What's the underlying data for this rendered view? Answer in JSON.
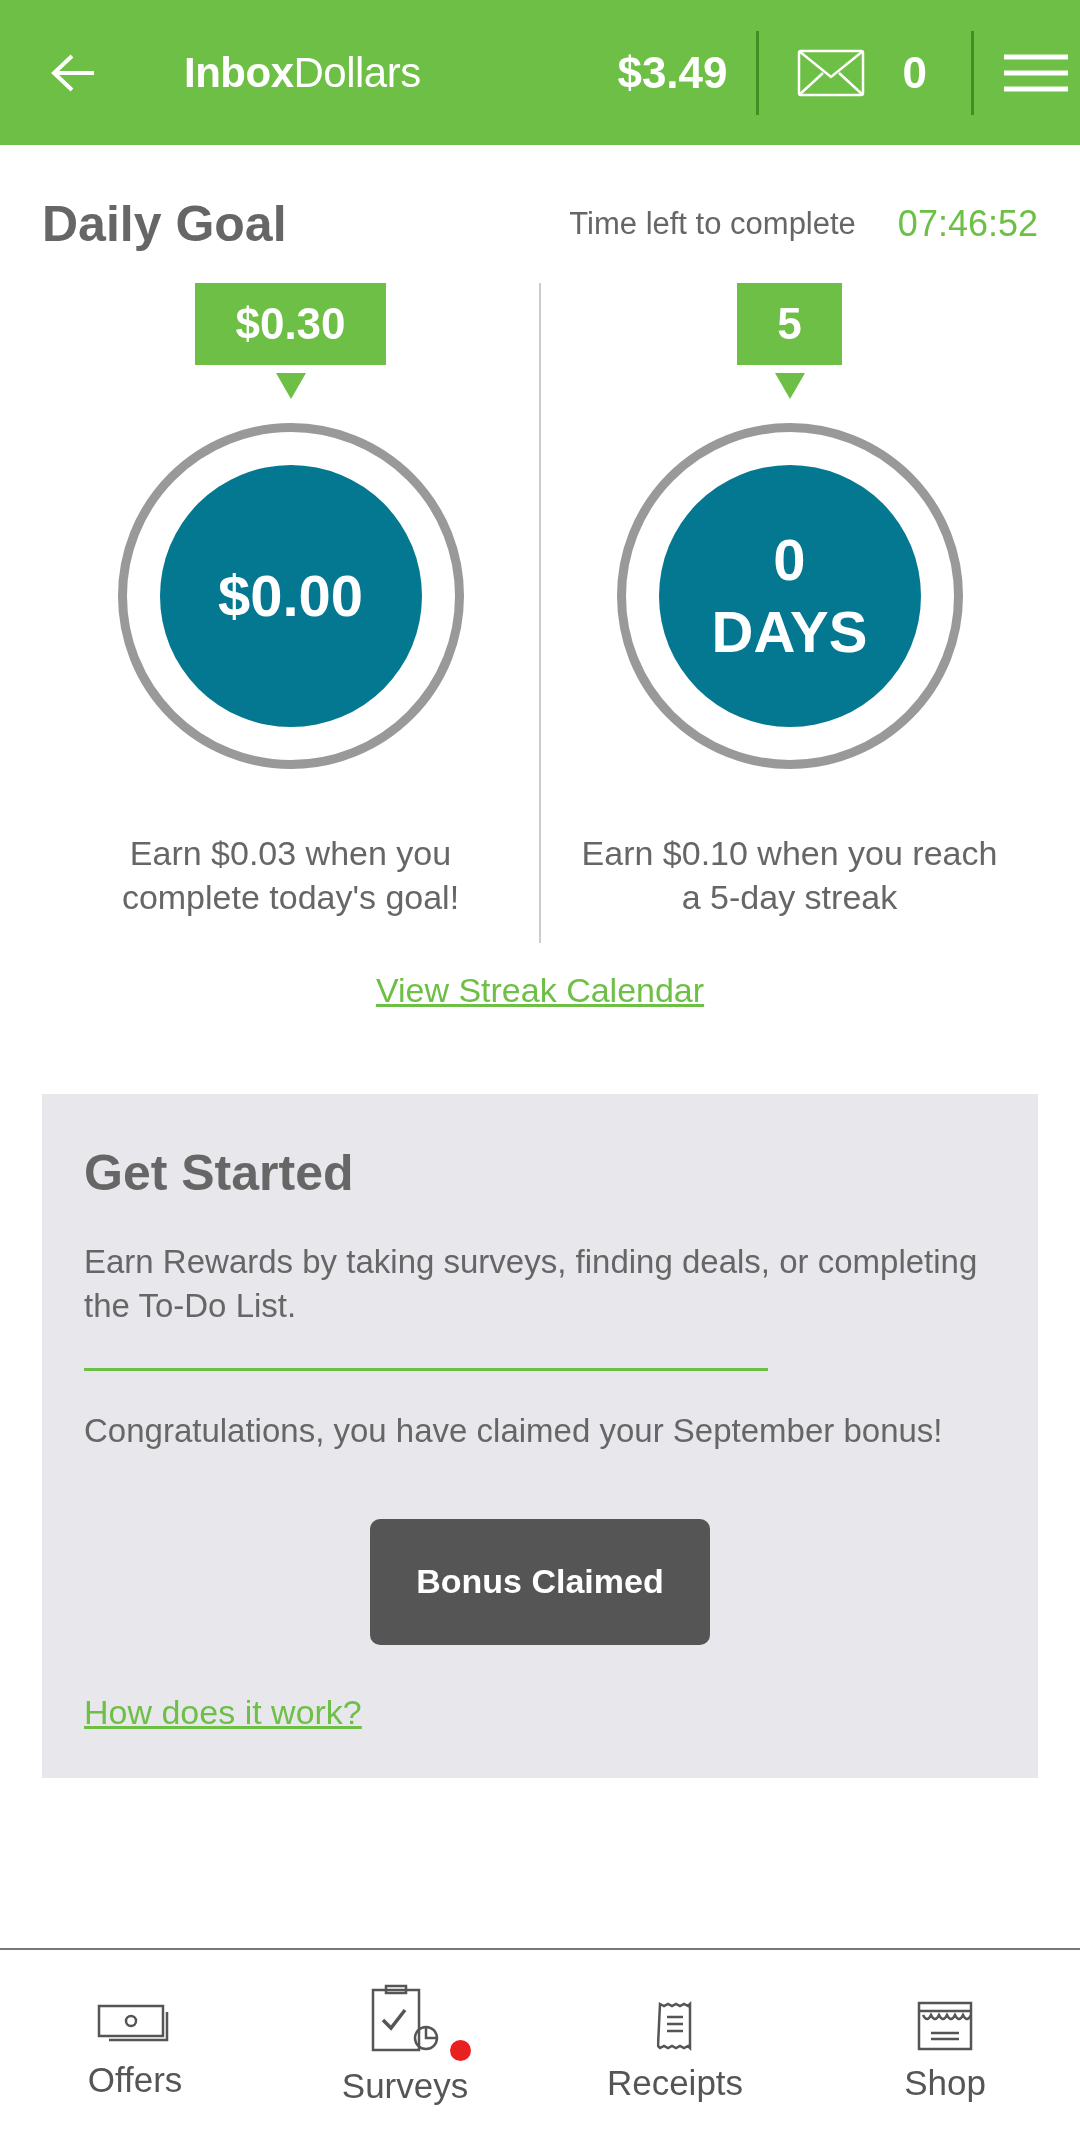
{
  "header": {
    "logo": "**Inbox**Dollars",
    "balance": "$3.49",
    "messages": "0"
  },
  "daily_goal": {
    "title": "Daily Goal",
    "time_label": "Time left to complete",
    "time_left": "07:46:52",
    "goals": [
      {
        "badge": "$0.30",
        "value_lines": [
          "$0.00"
        ],
        "caption": "Earn $0.03 when you complete today's goal!"
      },
      {
        "badge": "5",
        "value_lines": [
          "0",
          "DAYS"
        ],
        "caption": "Earn $0.10 when you reach a 5-day streak"
      }
    ],
    "link": "View Streak Calendar"
  },
  "card": {
    "title": "Get Started",
    "intro": "Earn Rewards by taking surveys, finding deals, or completing the To-Do List.",
    "message": "Congratulations, you have claimed your September bonus!",
    "button": {
      "label": "Bonus Claimed",
      "disabled": true
    },
    "link": "How does it work?"
  },
  "nav": [
    {
      "kind": "offers",
      "label": "Offers",
      "badge": false
    },
    {
      "kind": "surveys",
      "label": "Surveys",
      "badge": true
    },
    {
      "kind": "receipts",
      "label": "Receipts",
      "badge": false
    },
    {
      "kind": "shop",
      "label": "Shop",
      "badge": false
    }
  ]
}
